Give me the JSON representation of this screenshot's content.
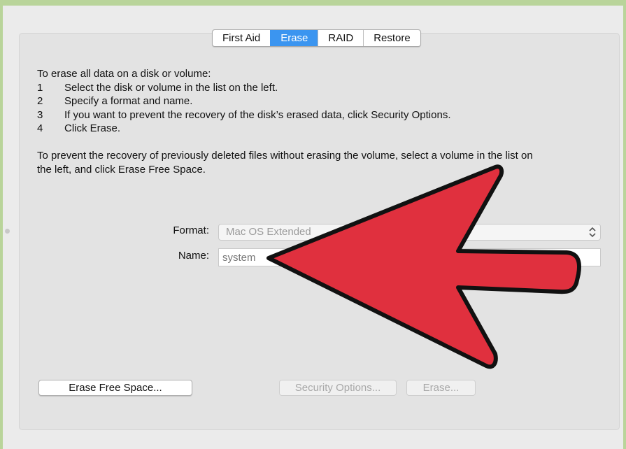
{
  "tabs": [
    {
      "label": "First Aid",
      "active": false
    },
    {
      "label": "Erase",
      "active": true
    },
    {
      "label": "RAID",
      "active": false
    },
    {
      "label": "Restore",
      "active": false
    }
  ],
  "instructions": {
    "intro": "To erase all data on a disk or volume:",
    "steps": [
      {
        "num": "1",
        "text": "Select the disk or volume in the list on the left."
      },
      {
        "num": "2",
        "text": "Specify a format and name."
      },
      {
        "num": "3",
        "text": "If you want to prevent the recovery of the disk’s erased data, click Security Options."
      },
      {
        "num": "4",
        "text": "Click Erase."
      }
    ],
    "free_space_line1": "To prevent the recovery of previously deleted files without erasing the volume, select a volume in the list on",
    "free_space_line2": "the left, and click Erase Free Space."
  },
  "form": {
    "format_label": "Format:",
    "format_value": "Mac OS Extended",
    "name_label": "Name:",
    "name_value": "system"
  },
  "buttons": {
    "erase_free_space": "Erase Free Space...",
    "security_options": "Security Options...",
    "erase": "Erase..."
  },
  "colors": {
    "accent": "#3b95f0",
    "arrow_fill": "#e0303e",
    "background": "#b9d49a"
  },
  "icons": [
    "chevron-updown-icon"
  ]
}
